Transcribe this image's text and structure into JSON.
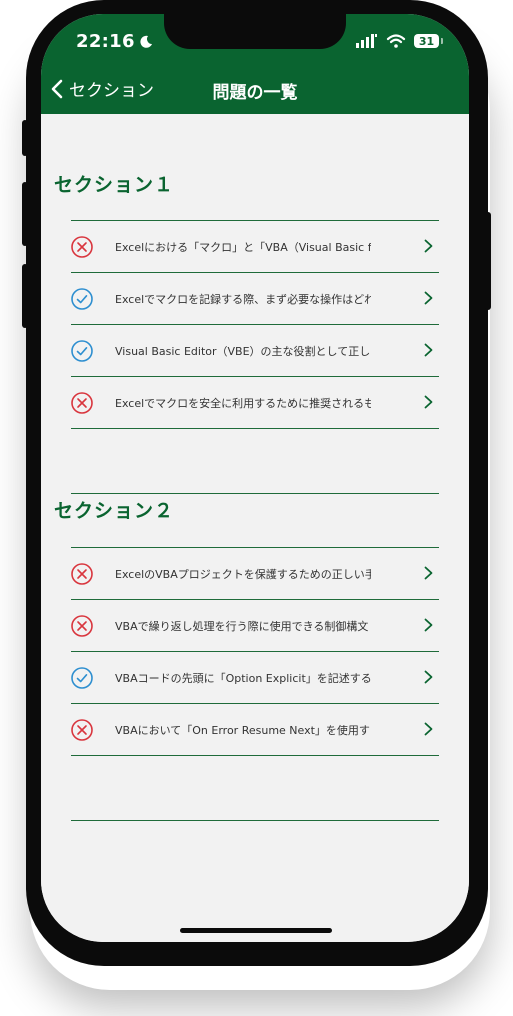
{
  "status_bar": {
    "time": "22:16",
    "battery": "31"
  },
  "nav": {
    "back_label": "セクション",
    "title": "問題の一覧"
  },
  "sections": [
    {
      "title": "セクション１",
      "items": [
        {
          "result": "incorrect",
          "text": "Excelにおける「マクロ」と「VBA（Visual Basic f"
        },
        {
          "result": "correct",
          "text": "Excelでマクロを記録する際、まず必要な操作はどれ"
        },
        {
          "result": "correct",
          "text": "Visual Basic Editor（VBE）の主な役割として正し"
        },
        {
          "result": "incorrect",
          "text": "Excelでマクロを安全に利用するために推奨されるも"
        }
      ]
    },
    {
      "title": "セクション２",
      "items": [
        {
          "result": "incorrect",
          "text": "ExcelのVBAプロジェクトを保護するための正しい手"
        },
        {
          "result": "incorrect",
          "text": "VBAで繰り返し処理を行う際に使用できる制御構文"
        },
        {
          "result": "correct",
          "text": "VBAコードの先頭に「Option Explicit」を記述する"
        },
        {
          "result": "incorrect",
          "text": "VBAにおいて「On Error Resume Next」を使用す"
        }
      ]
    }
  ],
  "colors": {
    "header": "#0a6430",
    "correct": "#2e8fd0",
    "incorrect": "#d9363e",
    "rule": "#1f6b3a"
  },
  "icons": {
    "correct": "check-circle-icon",
    "incorrect": "x-circle-icon",
    "chevron": "chevron-right-icon",
    "back": "chevron-left-icon"
  }
}
